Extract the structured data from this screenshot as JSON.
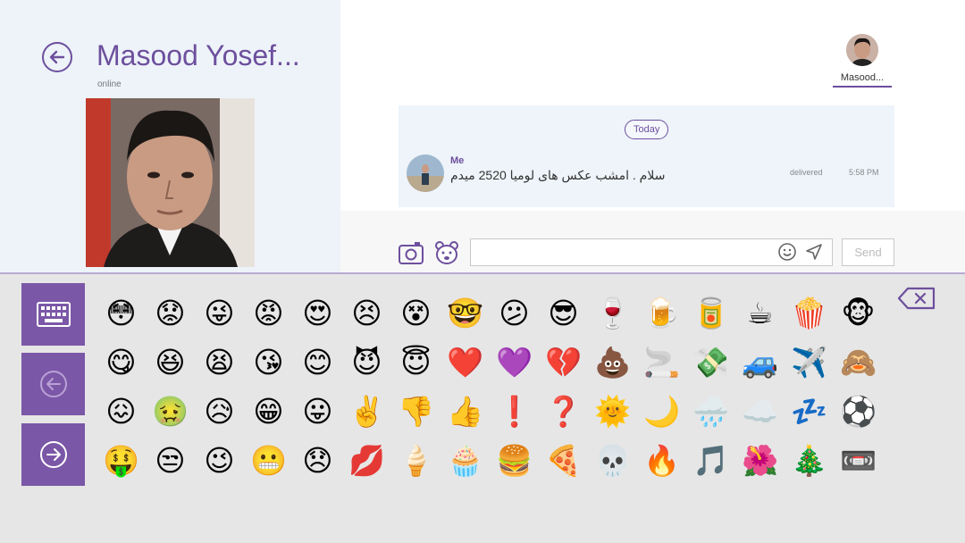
{
  "contact": {
    "name": "Masood Yosef...",
    "status": "online"
  },
  "participants": [
    {
      "name": "Masood..."
    }
  ],
  "chat": {
    "date_label": "Today",
    "messages": [
      {
        "sender": "Me",
        "text": "سلام . امشب عکس های لومیا 2520 میدم",
        "status": "delivered",
        "time": "5:58 PM"
      }
    ]
  },
  "composer": {
    "input_value": "",
    "send_label": "Send"
  },
  "emoji_keyboard": {
    "side_buttons": [
      "keyboard-icon",
      "arrow-left-icon",
      "arrow-right-icon"
    ],
    "emojis": [
      "😳",
      "😟",
      "😜",
      "😡",
      "😍",
      "😣",
      "😵",
      "🤓",
      "😕",
      "😎",
      "🍷",
      "🍺",
      "🥫",
      "☕",
      "🍿",
      "🐵",
      "😋",
      "😆",
      "😫",
      "😘",
      "😊",
      "😈",
      "😇",
      "❤️",
      "💜",
      "💔",
      "💩",
      "🚬",
      "💸",
      "🚙",
      "✈️",
      "🙈",
      "😖",
      "🤢",
      "😥",
      "😁",
      "😛",
      "✌️",
      "👎",
      "👍",
      "❗",
      "❓",
      "🌞",
      "🌙",
      "🌧️",
      "☁️",
      "💤",
      "⚽",
      "🤑",
      "😒",
      "😉",
      "😬",
      "😞",
      "💋",
      "🍦",
      "🧁",
      "🍔",
      "🍕",
      "💀",
      "🔥",
      "🎵",
      "🌺",
      "🎄",
      "📼"
    ]
  },
  "colors": {
    "accent": "#6d4f9d",
    "panel_button": "#7b57a7",
    "left_bg": "#edf3f9",
    "keyboard_bg": "#e6e6e6"
  }
}
